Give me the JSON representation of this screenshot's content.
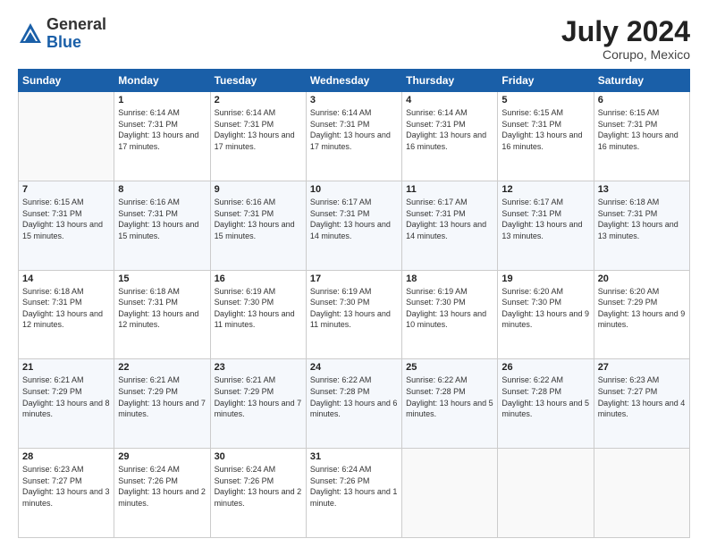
{
  "header": {
    "logo_general": "General",
    "logo_blue": "Blue",
    "month_year": "July 2024",
    "location": "Corupo, Mexico"
  },
  "days_of_week": [
    "Sunday",
    "Monday",
    "Tuesday",
    "Wednesday",
    "Thursday",
    "Friday",
    "Saturday"
  ],
  "weeks": [
    [
      {
        "day": "",
        "sunrise": "",
        "sunset": "",
        "daylight": ""
      },
      {
        "day": "1",
        "sunrise": "6:14 AM",
        "sunset": "7:31 PM",
        "daylight": "13 hours and 17 minutes."
      },
      {
        "day": "2",
        "sunrise": "6:14 AM",
        "sunset": "7:31 PM",
        "daylight": "13 hours and 17 minutes."
      },
      {
        "day": "3",
        "sunrise": "6:14 AM",
        "sunset": "7:31 PM",
        "daylight": "13 hours and 17 minutes."
      },
      {
        "day": "4",
        "sunrise": "6:14 AM",
        "sunset": "7:31 PM",
        "daylight": "13 hours and 16 minutes."
      },
      {
        "day": "5",
        "sunrise": "6:15 AM",
        "sunset": "7:31 PM",
        "daylight": "13 hours and 16 minutes."
      },
      {
        "day": "6",
        "sunrise": "6:15 AM",
        "sunset": "7:31 PM",
        "daylight": "13 hours and 16 minutes."
      }
    ],
    [
      {
        "day": "7",
        "sunrise": "6:15 AM",
        "sunset": "7:31 PM",
        "daylight": "13 hours and 15 minutes."
      },
      {
        "day": "8",
        "sunrise": "6:16 AM",
        "sunset": "7:31 PM",
        "daylight": "13 hours and 15 minutes."
      },
      {
        "day": "9",
        "sunrise": "6:16 AM",
        "sunset": "7:31 PM",
        "daylight": "13 hours and 15 minutes."
      },
      {
        "day": "10",
        "sunrise": "6:17 AM",
        "sunset": "7:31 PM",
        "daylight": "13 hours and 14 minutes."
      },
      {
        "day": "11",
        "sunrise": "6:17 AM",
        "sunset": "7:31 PM",
        "daylight": "13 hours and 14 minutes."
      },
      {
        "day": "12",
        "sunrise": "6:17 AM",
        "sunset": "7:31 PM",
        "daylight": "13 hours and 13 minutes."
      },
      {
        "day": "13",
        "sunrise": "6:18 AM",
        "sunset": "7:31 PM",
        "daylight": "13 hours and 13 minutes."
      }
    ],
    [
      {
        "day": "14",
        "sunrise": "6:18 AM",
        "sunset": "7:31 PM",
        "daylight": "13 hours and 12 minutes."
      },
      {
        "day": "15",
        "sunrise": "6:18 AM",
        "sunset": "7:31 PM",
        "daylight": "13 hours and 12 minutes."
      },
      {
        "day": "16",
        "sunrise": "6:19 AM",
        "sunset": "7:30 PM",
        "daylight": "13 hours and 11 minutes."
      },
      {
        "day": "17",
        "sunrise": "6:19 AM",
        "sunset": "7:30 PM",
        "daylight": "13 hours and 11 minutes."
      },
      {
        "day": "18",
        "sunrise": "6:19 AM",
        "sunset": "7:30 PM",
        "daylight": "13 hours and 10 minutes."
      },
      {
        "day": "19",
        "sunrise": "6:20 AM",
        "sunset": "7:30 PM",
        "daylight": "13 hours and 9 minutes."
      },
      {
        "day": "20",
        "sunrise": "6:20 AM",
        "sunset": "7:29 PM",
        "daylight": "13 hours and 9 minutes."
      }
    ],
    [
      {
        "day": "21",
        "sunrise": "6:21 AM",
        "sunset": "7:29 PM",
        "daylight": "13 hours and 8 minutes."
      },
      {
        "day": "22",
        "sunrise": "6:21 AM",
        "sunset": "7:29 PM",
        "daylight": "13 hours and 7 minutes."
      },
      {
        "day": "23",
        "sunrise": "6:21 AM",
        "sunset": "7:29 PM",
        "daylight": "13 hours and 7 minutes."
      },
      {
        "day": "24",
        "sunrise": "6:22 AM",
        "sunset": "7:28 PM",
        "daylight": "13 hours and 6 minutes."
      },
      {
        "day": "25",
        "sunrise": "6:22 AM",
        "sunset": "7:28 PM",
        "daylight": "13 hours and 5 minutes."
      },
      {
        "day": "26",
        "sunrise": "6:22 AM",
        "sunset": "7:28 PM",
        "daylight": "13 hours and 5 minutes."
      },
      {
        "day": "27",
        "sunrise": "6:23 AM",
        "sunset": "7:27 PM",
        "daylight": "13 hours and 4 minutes."
      }
    ],
    [
      {
        "day": "28",
        "sunrise": "6:23 AM",
        "sunset": "7:27 PM",
        "daylight": "13 hours and 3 minutes."
      },
      {
        "day": "29",
        "sunrise": "6:24 AM",
        "sunset": "7:26 PM",
        "daylight": "13 hours and 2 minutes."
      },
      {
        "day": "30",
        "sunrise": "6:24 AM",
        "sunset": "7:26 PM",
        "daylight": "13 hours and 2 minutes."
      },
      {
        "day": "31",
        "sunrise": "6:24 AM",
        "sunset": "7:26 PM",
        "daylight": "13 hours and 1 minute."
      },
      {
        "day": "",
        "sunrise": "",
        "sunset": "",
        "daylight": ""
      },
      {
        "day": "",
        "sunrise": "",
        "sunset": "",
        "daylight": ""
      },
      {
        "day": "",
        "sunrise": "",
        "sunset": "",
        "daylight": ""
      }
    ]
  ]
}
